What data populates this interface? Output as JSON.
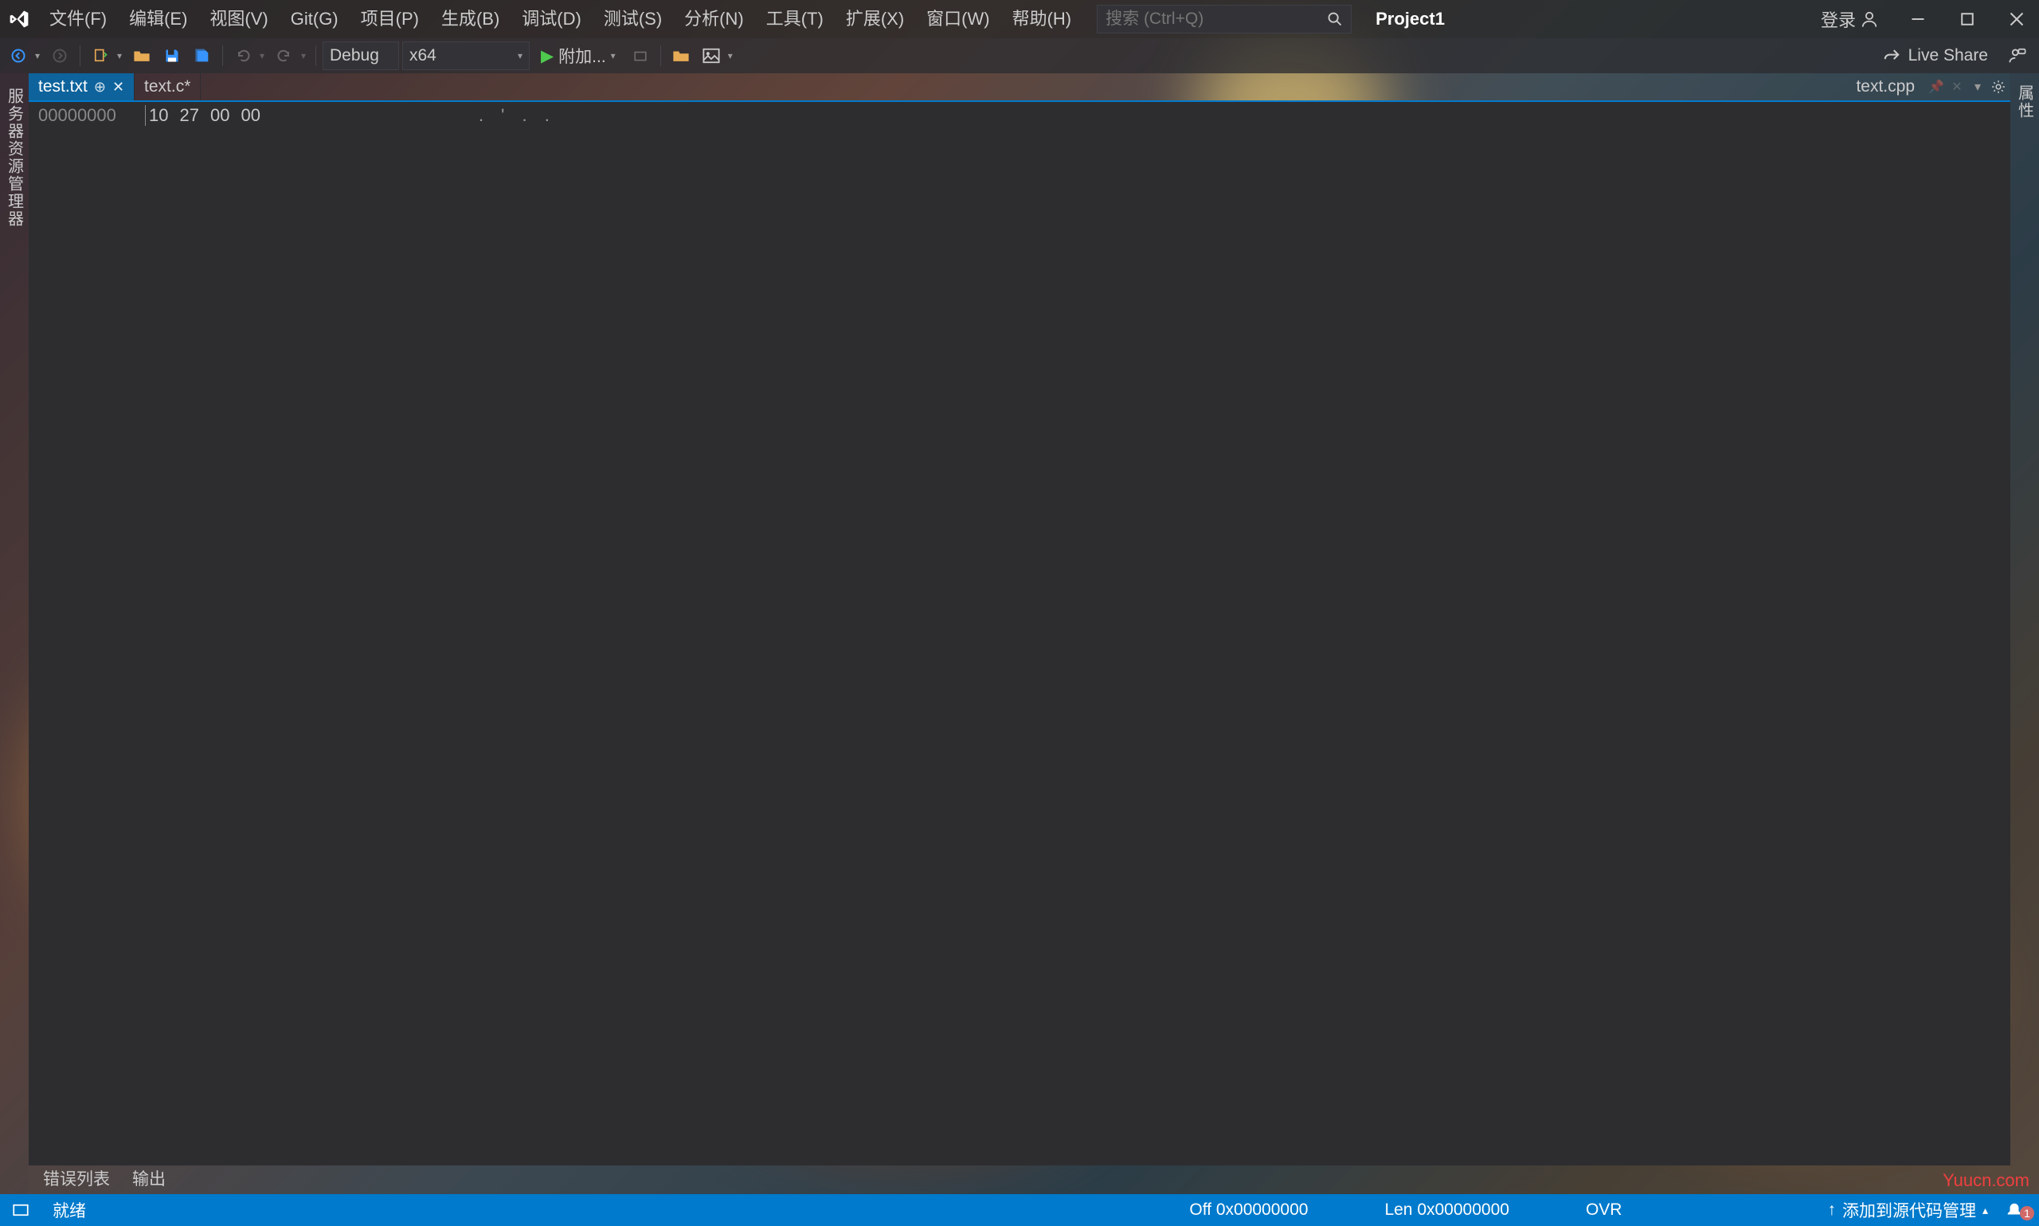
{
  "menu": {
    "items": [
      "文件(F)",
      "编辑(E)",
      "视图(V)",
      "Git(G)",
      "项目(P)",
      "生成(B)",
      "调试(D)",
      "测试(S)",
      "分析(N)",
      "工具(T)",
      "扩展(X)",
      "窗口(W)",
      "帮助(H)"
    ]
  },
  "search": {
    "placeholder": "搜索 (Ctrl+Q)"
  },
  "project_name": "Project1",
  "title_right": {
    "login": "登录"
  },
  "toolbar": {
    "config": "Debug",
    "platform": "x64",
    "attach": "附加..."
  },
  "live_share": "Live Share",
  "side_left": {
    "label": "服务器资源管理器"
  },
  "side_right": {
    "label": "属性"
  },
  "tabs": {
    "active": {
      "name": "test.txt"
    },
    "others": [
      "text.c*"
    ],
    "right_doc": "text.cpp"
  },
  "hex": {
    "offset": "00000000",
    "bytes": [
      "10",
      "27",
      "00",
      "00"
    ],
    "ascii": ". ' . ."
  },
  "bottom_panels": [
    "错误列表",
    "输出"
  ],
  "status": {
    "ready": "就绪",
    "off": "Off 0x00000000",
    "len": "Len 0x00000000",
    "mode": "OVR",
    "source_control": "添加到源代码管理",
    "notif_count": "1"
  },
  "watermark": "Yuucn.com"
}
